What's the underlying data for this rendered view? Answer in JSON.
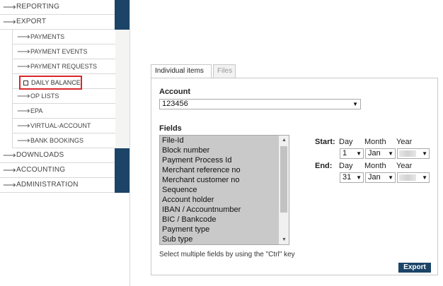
{
  "nav": {
    "main_top": [
      {
        "label": "REPORTING"
      },
      {
        "label": "EXPORT"
      }
    ],
    "sub": [
      {
        "label": "PAYMENTS"
      },
      {
        "label": "PAYMENT EVENTS"
      },
      {
        "label": "PAYMENT REQUESTS"
      },
      {
        "label": "DAILY BALANCE",
        "active": true
      },
      {
        "label": "OP LISTS"
      },
      {
        "label": "EPA"
      },
      {
        "label": "VIRTUAL-ACCOUNT"
      },
      {
        "label": "BANK BOOKINGS"
      }
    ],
    "main_bottom": [
      {
        "label": "DOWNLOADS"
      },
      {
        "label": "ACCOUNTING"
      },
      {
        "label": "ADMINISTRATION"
      }
    ]
  },
  "tabs": [
    {
      "label": "Individual items",
      "active": true
    },
    {
      "label": "Files",
      "active": false
    }
  ],
  "account": {
    "label": "Account",
    "value": "123456"
  },
  "fields": {
    "label": "Fields",
    "options": [
      "File-Id",
      "Block number",
      "Payment Process Id",
      "Merchant reference no",
      "Merchant customer no",
      "Sequence",
      "Account holder",
      "IBAN / Accountnumber",
      "BIC / Bankcode",
      "Payment type",
      "Sub type"
    ],
    "hint": "Select multiple fields by using the \"Ctrl\" key"
  },
  "date_range": {
    "start_label": "Start:",
    "end_label": "End:",
    "col_day": "Day",
    "col_month": "Month",
    "col_year": "Year",
    "start": {
      "day": "1",
      "month": "Jan"
    },
    "end": {
      "day": "31",
      "month": "Jan"
    }
  },
  "export_button": "Export",
  "colors": {
    "nav_band": "#1b4467",
    "active_outline": "#d9262b",
    "button": "#1b4467"
  }
}
